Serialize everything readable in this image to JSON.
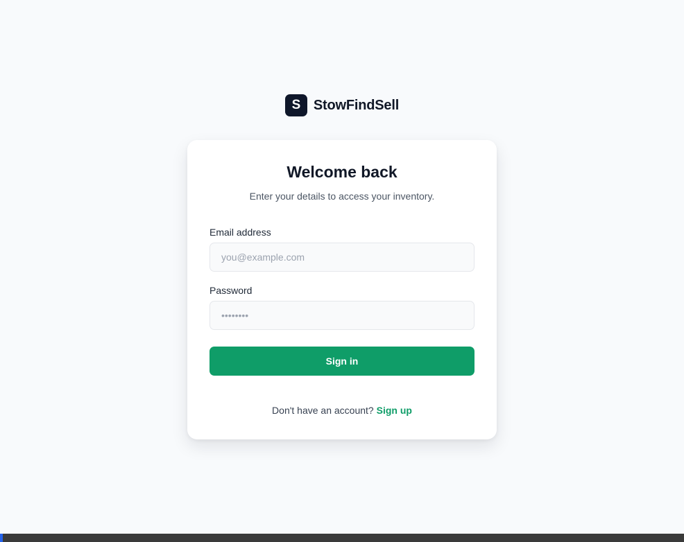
{
  "brand": {
    "mark": "S",
    "name": "StowFindSell"
  },
  "card": {
    "title": "Welcome back",
    "subtitle": "Enter your details to access your inventory."
  },
  "form": {
    "email_label": "Email address",
    "email_placeholder": "you@example.com",
    "email_value": "",
    "password_label": "Password",
    "password_placeholder": "••••••••",
    "password_value": "",
    "submit_label": "Sign in"
  },
  "footer": {
    "prompt": "Don't have an account?",
    "signup_label": "Sign up"
  },
  "colors": {
    "accent": "#0f9d68",
    "brand_mark": "#0f172a",
    "background": "#f8fafc"
  }
}
